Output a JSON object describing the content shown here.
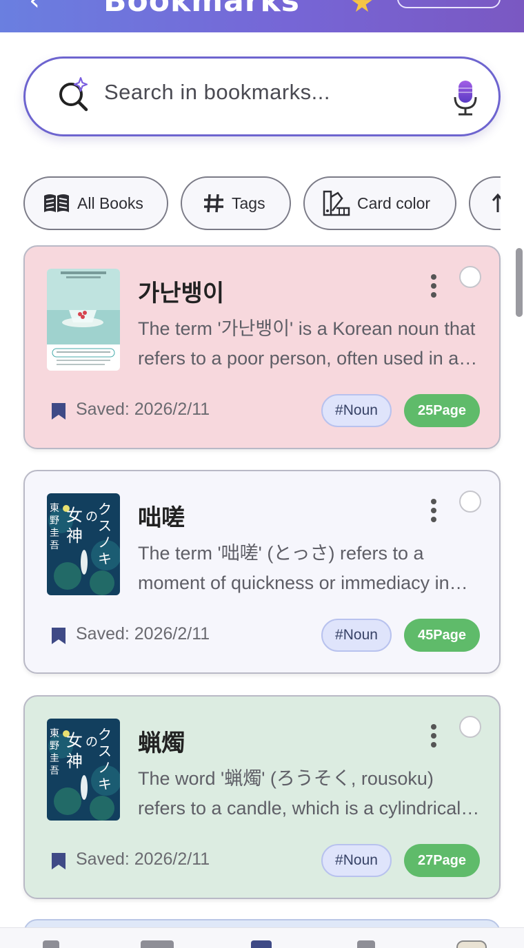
{
  "header": {
    "title": "Bookmarks",
    "back_icon": "arrow-left-icon",
    "star_icon": "star-icon"
  },
  "search": {
    "placeholder": "Search in bookmarks...",
    "icon": "ai-search-icon",
    "mic_icon": "microphone-icon"
  },
  "filters": [
    {
      "label": "All Books",
      "icon": "open-book-icon"
    },
    {
      "label": "Tags",
      "icon": "hashtag-icon"
    },
    {
      "label": "Card color",
      "icon": "color-palette-icon"
    },
    {
      "label": "",
      "icon": "sort-arrow-icon"
    }
  ],
  "cards": [
    {
      "word": "가난뱅이",
      "description": "The term '가난뱅이' is a Korean noun that refers to a poor person, often used in a derogatory way.",
      "saved": "Saved: 2026/2/11",
      "tag": "#Noun",
      "page": "25Page",
      "card_color": "#f7d8dd",
      "cover": "korean-essay-cover"
    },
    {
      "word": "咄嗟",
      "description": "The term '咄嗟' (とっさ) refers to a moment of quickness or immediacy in reaction.",
      "saved": "Saved: 2026/2/11",
      "tag": "#Noun",
      "page": "45Page",
      "card_color": "#f6f6fc",
      "cover": "kusunoki-no-megami-cover"
    },
    {
      "word": "蝋燭",
      "description": "The word '蝋燭' (ろうそく, rousoku) refers to a candle, which is a cylindrical block of wax.",
      "saved": "Saved: 2026/2/11",
      "tag": "#Noun",
      "page": "27Page",
      "card_color": "#dcece1",
      "cover": "kusunoki-no-megami-cover"
    }
  ],
  "colors": {
    "header_gradient_start": "#6a7fe0",
    "header_gradient_end": "#7a58c2",
    "accent": "#6d64cf",
    "page_badge": "#5fbb6a",
    "tag_badge": "#dfe4fb"
  }
}
